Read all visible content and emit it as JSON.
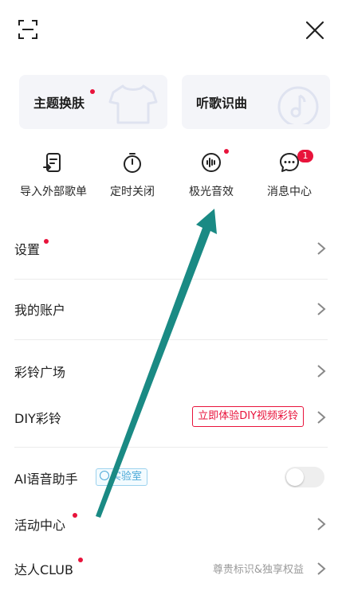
{
  "header": {
    "scan_icon": "scan-icon",
    "close_icon": "close-icon"
  },
  "cards": [
    {
      "label": "主题换肤",
      "has_dot": true,
      "icon": "tshirt-icon"
    },
    {
      "label": "听歌识曲",
      "has_dot": false,
      "icon": "music-note-icon"
    }
  ],
  "quick": [
    {
      "label": "导入外部歌单",
      "icon": "import-playlist-icon"
    },
    {
      "label": "定时关闭",
      "icon": "timer-icon"
    },
    {
      "label": "极光音效",
      "icon": "sound-effect-icon",
      "has_dot": true
    },
    {
      "label": "消息中心",
      "icon": "message-icon",
      "badge": "1"
    }
  ],
  "rows": {
    "settings": {
      "label": "设置"
    },
    "account": {
      "label": "我的账户"
    },
    "ringtone_plaza": {
      "label": "彩铃广场"
    },
    "diy_ringtone": {
      "label": "DIY彩铃",
      "action": "立即体验DIY视频彩铃"
    },
    "ai_assistant": {
      "label": "AI语音助手",
      "tag": "实验室"
    },
    "activity": {
      "label": "活动中心"
    },
    "club": {
      "label": "达人CLUB",
      "subtext": "尊贵标识&独享权益"
    }
  },
  "colors": {
    "accent_red": "#e8133b",
    "arrow": "#1a8a84",
    "card_bg": "#f4f5f9"
  }
}
